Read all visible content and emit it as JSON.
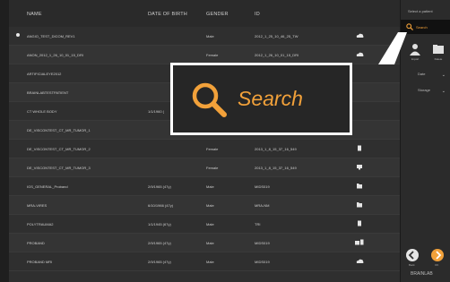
{
  "table": {
    "headers": {
      "name": "NAME",
      "dob": "DATE OF BIRTH",
      "gender": "GENDER",
      "id": "ID"
    },
    "rows": [
      {
        "name": "ANGIO_TEST_DICOM_REV1",
        "dob": "",
        "gender": "Male",
        "id": "2012_1_25_10_46_25_TW",
        "icon": "cloud-icon",
        "selected": true
      },
      {
        "name": "ANON_2012_1_26_10_01_15_DRI",
        "dob": "",
        "gender": "Female",
        "id": "2012_1_26_10_01_15_DRI",
        "icon": "cloud-icon",
        "selected": false
      },
      {
        "name": "ARTIFICIALEYE2012",
        "dob": "",
        "gender": "",
        "id": "",
        "icon": "",
        "selected": false
      },
      {
        "name": "BRAINLABTESTPATIENT",
        "dob": "",
        "gender": "",
        "id": "",
        "icon": "",
        "selected": false
      },
      {
        "name": "CT WHOLE BODY",
        "dob": "1/1/1960 (",
        "gender": "",
        "id": "",
        "icon": "",
        "selected": false
      },
      {
        "name": "DE_VISCONTEST_CT_MR_TUMOR_1",
        "dob": "",
        "gender": "",
        "id": "",
        "icon": "",
        "selected": false
      },
      {
        "name": "DE_VISCONTEST_CT_MR_TUMOR_2",
        "dob": "",
        "gender": "Female",
        "id": "2013_1_8_15_37_16_549",
        "icon": "document-icon",
        "selected": false
      },
      {
        "name": "DE_VISCONTEST_CT_MR_TUMOR_3",
        "dob": "",
        "gender": "Female",
        "id": "2013_1_8_15_37_16_549",
        "icon": "monitor-icon",
        "selected": false
      },
      {
        "name": "IGS_GENERAL_Proband",
        "dob": "2/9/1965 (47y)",
        "gender": "Male",
        "id": "MIDS019",
        "icon": "folder-icon",
        "selected": false
      },
      {
        "name": "MRA-VIRES",
        "dob": "6/10/1966 (47y)",
        "gender": "Male",
        "id": "MRA-NM",
        "icon": "folder-icon",
        "selected": false
      },
      {
        "name": "POLYTRAUMA2",
        "dob": "1/1/1945 (67y)",
        "gender": "Male",
        "id": "TRI",
        "icon": "document-icon",
        "selected": false
      },
      {
        "name": "PROBAND",
        "dob": "2/9/1965 (47y)",
        "gender": "Male",
        "id": "MIDS019",
        "icon": "folder-doc-icon",
        "selected": false
      },
      {
        "name": "PROBAND MRI",
        "dob": "2/9/1965 (47y)",
        "gender": "Male",
        "id": "MIDS019",
        "icon": "cloud-icon",
        "selected": false
      }
    ]
  },
  "sidebar": {
    "title": "Select a patient",
    "search_label": "Search",
    "tool1_label": "Import",
    "tool2_label": "Delete",
    "dropdown1": "Date",
    "dropdown2": "Storage",
    "back_label": "Back",
    "next_label": "OK"
  },
  "callout": {
    "label": "Search"
  },
  "brand": "BRAINLAB",
  "colors": {
    "accent": "#f2a13a",
    "background": "#2f2f2f",
    "sidebar": "#2b2b2b"
  }
}
